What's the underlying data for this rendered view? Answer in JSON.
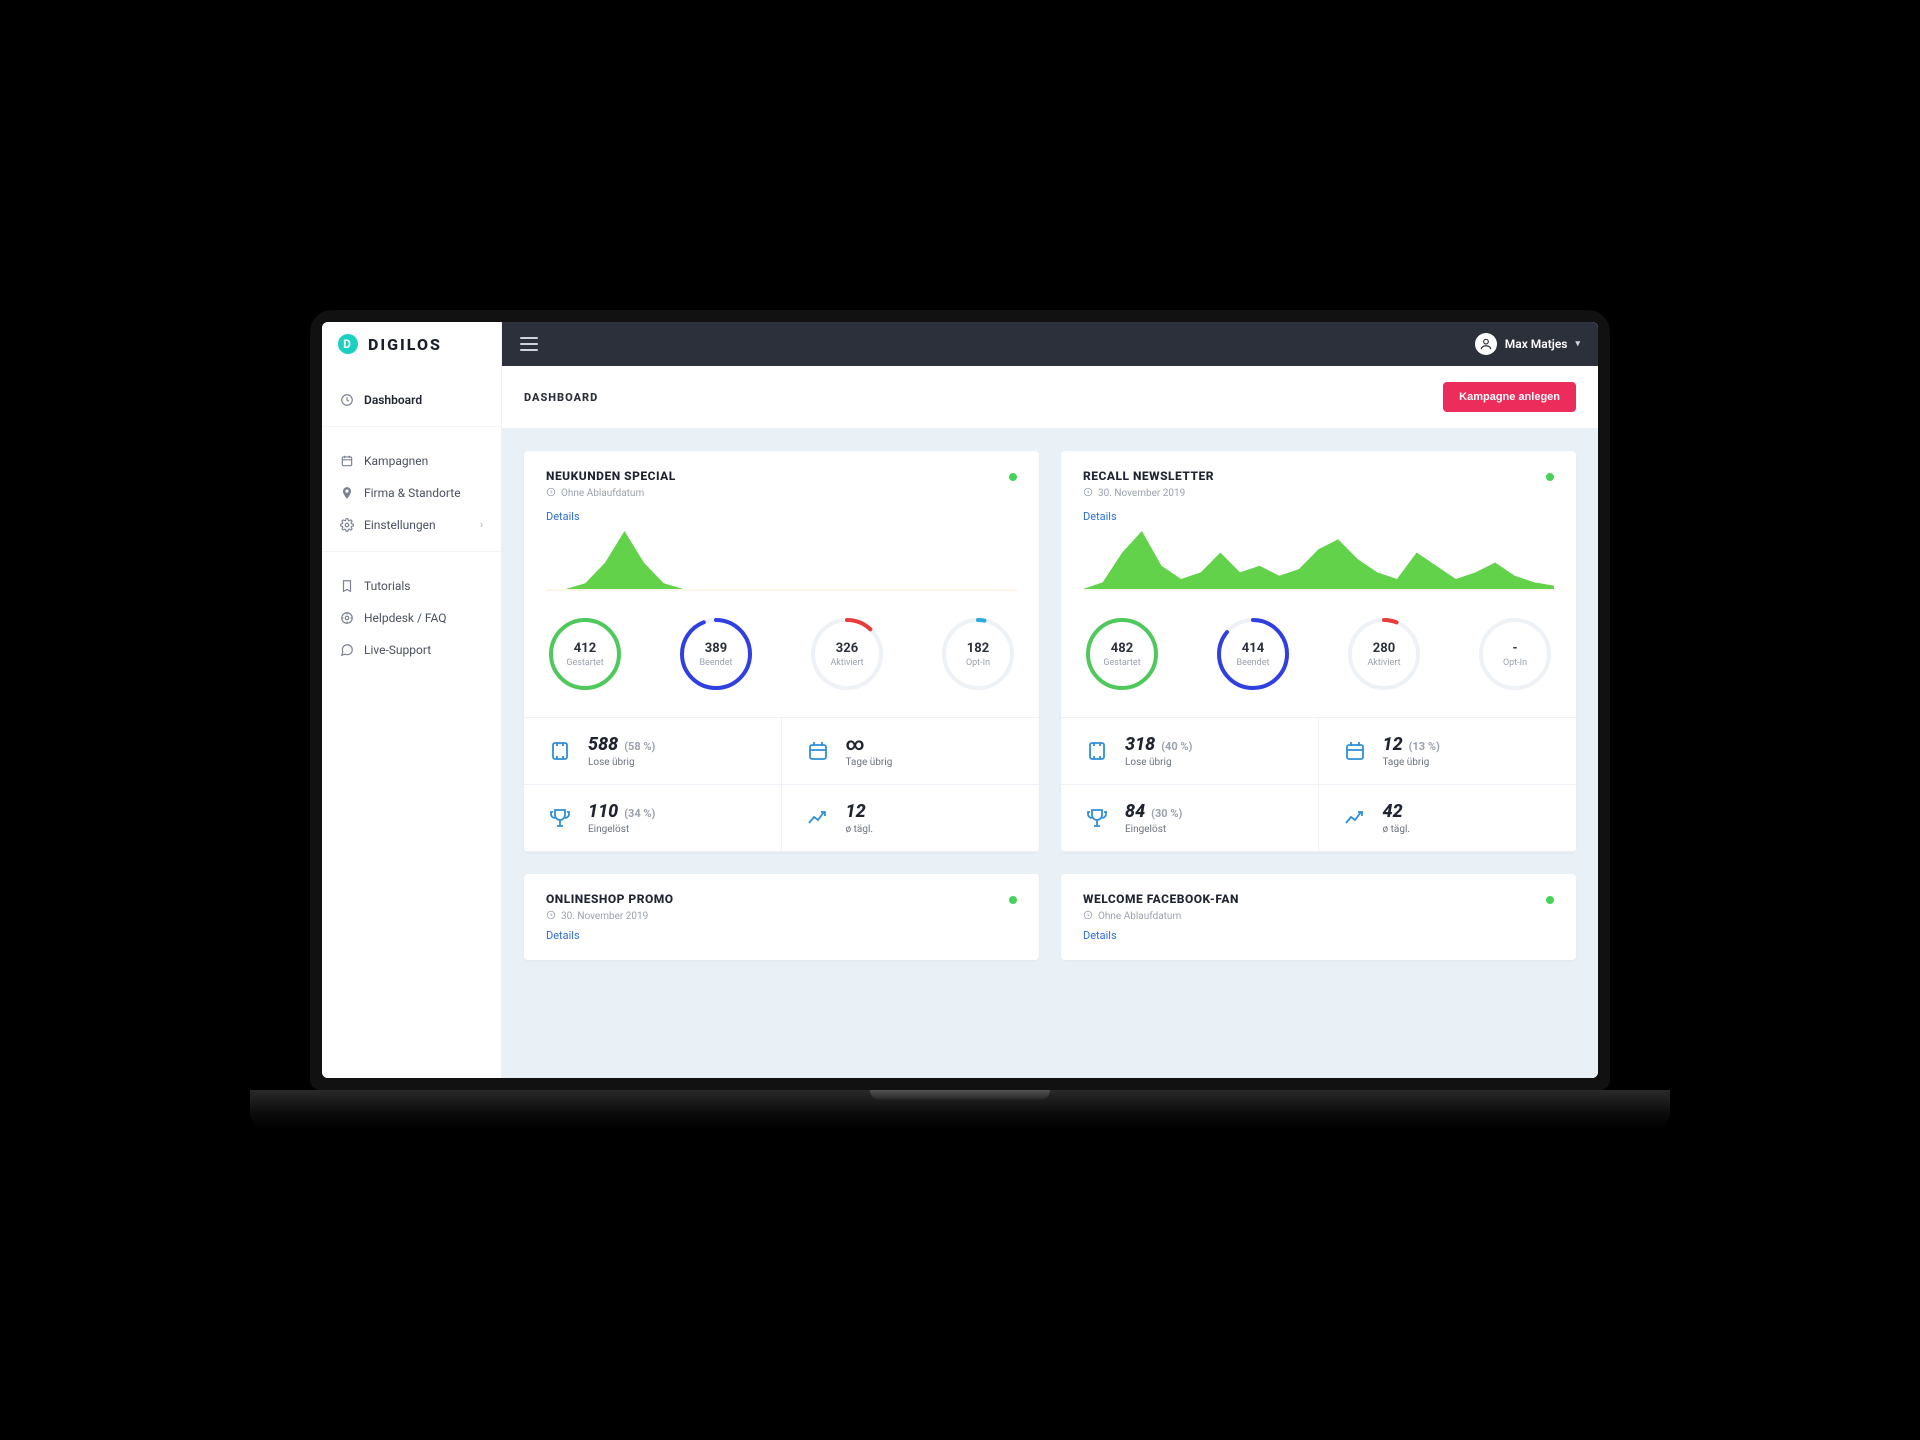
{
  "brand": {
    "name": "DIGILOS",
    "mark": "D"
  },
  "user": {
    "name": "Max Matjes"
  },
  "page": {
    "title": "DASHBOARD",
    "primary_button": "Kampagne anlegen"
  },
  "sidebar": {
    "items": [
      {
        "label": "Dashboard",
        "icon": "dashboard-icon",
        "active": true
      },
      {
        "label": "Kampagnen",
        "icon": "campaign-icon"
      },
      {
        "label": "Firma & Standorte",
        "icon": "location-icon"
      },
      {
        "label": "Einstellungen",
        "icon": "gear-icon",
        "chevron": true
      },
      {
        "label": "Tutorials",
        "icon": "book-icon"
      },
      {
        "label": "Helpdesk / FAQ",
        "icon": "help-icon"
      },
      {
        "label": "Live-Support",
        "icon": "chat-icon"
      }
    ]
  },
  "colors": {
    "accent": "#1bd0c1",
    "primary_btn": "#ec2c5a",
    "ring_green": "#4fc95b",
    "ring_blue": "#2f3fe0",
    "ring_red": "#e83b3b",
    "link": "#2f6fd6",
    "spark": "#63d24b"
  },
  "details_label": "Details",
  "campaigns": [
    {
      "title": "NEUKUNDEN SPECIAL",
      "subtitle": "Ohne Ablaufdatum",
      "status": "active",
      "rings": [
        {
          "value": "412",
          "label": "Gestartet",
          "pct": 100,
          "color": "#4fc95b"
        },
        {
          "value": "389",
          "label": "Beendet",
          "pct": 94,
          "color": "#2f3fe0"
        },
        {
          "value": "326",
          "label": "Aktiviert",
          "pct": 12,
          "color": "#e83b3b"
        },
        {
          "value": "182",
          "label": "Opt-In",
          "pct": 3,
          "color": "#2aa9e0"
        }
      ],
      "stats": {
        "lose_num": "588",
        "lose_pct": "(58 %)",
        "lose_lbl": "Lose übrig",
        "tage_inf": true,
        "tage_num": "",
        "tage_pct": "",
        "tage_lbl": "Tage übrig",
        "eing_num": "110",
        "eing_pct": "(34 %)",
        "eing_lbl": "Eingelöst",
        "avg_num": "12",
        "avg_lbl": "ø tägl."
      },
      "chart_data": {
        "type": "area",
        "series": "single-peak",
        "points": [
          0,
          0,
          4,
          18,
          40,
          18,
          4,
          0,
          0,
          0,
          0,
          0,
          0,
          0,
          0,
          0,
          0,
          0,
          0,
          0,
          0,
          0,
          0,
          0,
          0
        ]
      }
    },
    {
      "title": "RECALL NEWSLETTER",
      "subtitle": "30. November 2019",
      "status": "active",
      "rings": [
        {
          "value": "482",
          "label": "Gestartet",
          "pct": 100,
          "color": "#4fc95b"
        },
        {
          "value": "414",
          "label": "Beendet",
          "pct": 86,
          "color": "#2f3fe0"
        },
        {
          "value": "280",
          "label": "Aktiviert",
          "pct": 6,
          "color": "#e83b3b"
        },
        {
          "value": "-",
          "label": "Opt-In",
          "pct": 0,
          "color": "#2aa9e0"
        }
      ],
      "stats": {
        "lose_num": "318",
        "lose_pct": "(40 %)",
        "lose_lbl": "Lose übrig",
        "tage_inf": false,
        "tage_num": "12",
        "tage_pct": "(13 %)",
        "tage_lbl": "Tage übrig",
        "eing_num": "84",
        "eing_pct": "(30 %)",
        "eing_lbl": "Eingelöst",
        "avg_num": "42",
        "avg_lbl": "ø tägl."
      },
      "chart_data": {
        "type": "area",
        "series": "multi-peak",
        "points": [
          0,
          4,
          22,
          35,
          14,
          6,
          10,
          22,
          10,
          14,
          8,
          12,
          24,
          30,
          18,
          10,
          6,
          22,
          14,
          6,
          10,
          16,
          8,
          4,
          2
        ]
      }
    },
    {
      "title": "ONLINESHOP PROMO",
      "subtitle": "30. November 2019",
      "status": "active"
    },
    {
      "title": "WELCOME FACEBOOK-FAN",
      "subtitle": "Ohne Ablaufdatum",
      "status": "active"
    }
  ]
}
